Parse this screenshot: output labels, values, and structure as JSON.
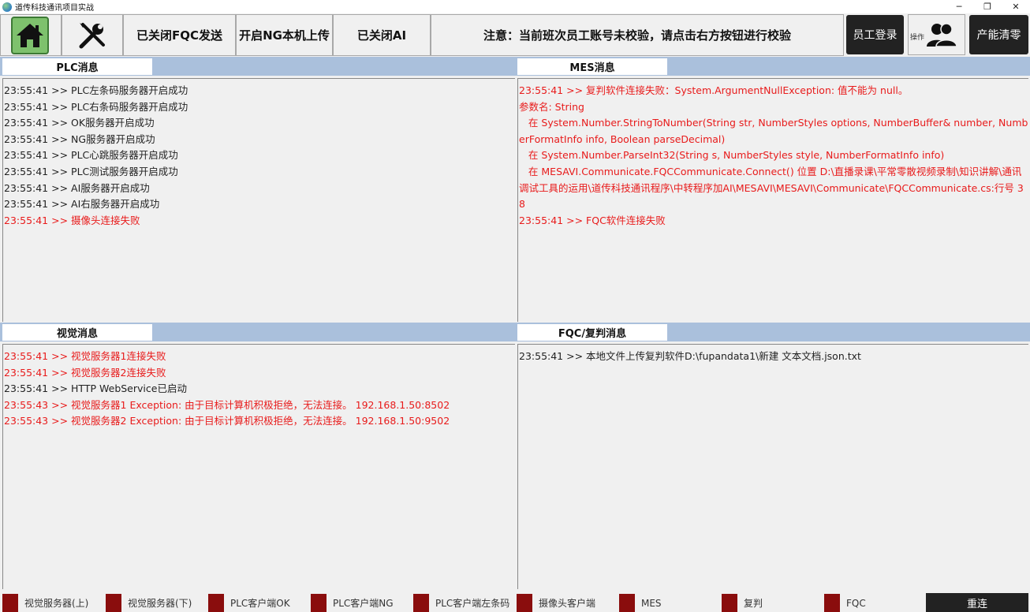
{
  "window": {
    "title": "道传科技通讯项目实战",
    "minimize": "─",
    "restore": "❐",
    "close": "✕"
  },
  "toolbar": {
    "fqc_label": "已关闭FQC发送",
    "ng_label": "开启NG本机上传",
    "ai_label": "已关闭AI",
    "notice": "注意：当前班次员工账号未校验，请点击右方按钮进行校验",
    "login_label": "员工登录",
    "operator_label": "操作",
    "clear_label": "产能清零"
  },
  "panels": {
    "plc": {
      "title": "PLC消息",
      "lines": [
        {
          "text": "23:55:41 >> PLC左条码服务器开启成功",
          "error": false
        },
        {
          "text": "23:55:41 >> PLC右条码服务器开启成功",
          "error": false
        },
        {
          "text": "23:55:41 >> OK服务器开启成功",
          "error": false
        },
        {
          "text": "23:55:41 >> NG服务器开启成功",
          "error": false
        },
        {
          "text": "23:55:41 >> PLC心跳服务器开启成功",
          "error": false
        },
        {
          "text": "23:55:41 >> PLC测试服务器开启成功",
          "error": false
        },
        {
          "text": "23:55:41 >> AI服务器开启成功",
          "error": false
        },
        {
          "text": "23:55:41 >> AI右服务器开启成功",
          "error": false
        },
        {
          "text": "23:55:41 >> 摄像头连接失败",
          "error": true
        }
      ]
    },
    "mes": {
      "title": "MES消息",
      "lines": [
        {
          "text": "23:55:41 >> 复判软件连接失败：System.ArgumentNullException: 值不能为 null。",
          "error": true
        },
        {
          "text": "参数名: String",
          "error": true
        },
        {
          "text": "   在 System.Number.StringToNumber(String str, NumberStyles options, NumberBuffer& number, NumberFormatInfo info, Boolean parseDecimal)",
          "error": true
        },
        {
          "text": "   在 System.Number.ParseInt32(String s, NumberStyles style, NumberFormatInfo info)",
          "error": true
        },
        {
          "text": "   在 MESAVI.Communicate.FQCCommunicate.Connect() 位置 D:\\直播录课\\平常零散视频录制\\知识讲解\\通讯调试工具的运用\\道传科技通讯程序\\中转程序加AI\\MESAVI\\MESAVI\\Communicate\\FQCCommunicate.cs:行号 38",
          "error": true
        },
        {
          "text": "23:55:41 >> FQC软件连接失败",
          "error": true
        }
      ]
    },
    "vision": {
      "title": "视觉消息",
      "lines": [
        {
          "text": "23:55:41 >> 视觉服务器1连接失败",
          "error": true
        },
        {
          "text": "23:55:41 >> 视觉服务器2连接失败",
          "error": true
        },
        {
          "text": "23:55:41 >> HTTP WebService已启动",
          "error": false
        },
        {
          "text": "23:55:43 >> 视觉服务器1 Exception: 由于目标计算机积极拒绝，无法连接。 192.168.1.50:8502",
          "error": true
        },
        {
          "text": "23:55:43 >> 视觉服务器2 Exception: 由于目标计算机积极拒绝，无法连接。 192.168.1.50:9502",
          "error": true
        }
      ]
    },
    "fqc": {
      "title": "FQC/复判消息",
      "lines": [
        {
          "text": "23:55:41 >> 本地文件上传复判软件D:\\fupandata1\\新建 文本文档.json.txt",
          "error": false
        }
      ]
    }
  },
  "status": {
    "indicators": [
      "视觉服务器(上)",
      "视觉服务器(下)",
      "PLC客户端OK",
      "PLC客户端NG",
      "PLC客户端左条码",
      "摄像头客户端",
      "MES",
      "复判",
      "FQC"
    ],
    "indicator_color": "#8a0d0d",
    "reconnect_label": "重连"
  },
  "colors": {
    "error_text": "#e81b1b",
    "header_bar": "#aac0dc",
    "home_green": "#7ec16d"
  },
  "icons": [
    "home-icon",
    "tools-icon",
    "users-icon"
  ]
}
